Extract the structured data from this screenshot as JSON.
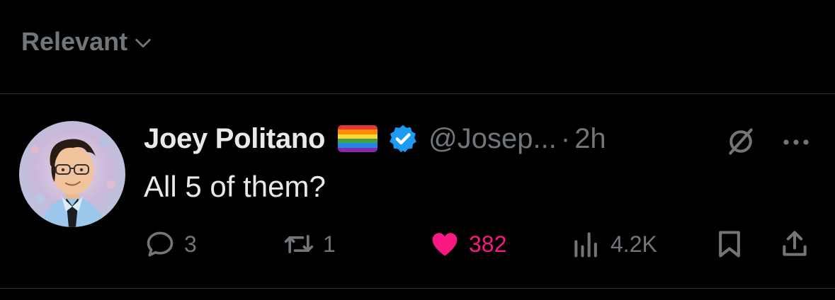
{
  "filter": {
    "label": "Relevant"
  },
  "post": {
    "display_name": "Joey Politano",
    "handle": "@Josep...",
    "separator": "·",
    "time": "2h",
    "text": "All 5 of them?",
    "stats": {
      "replies": "3",
      "reposts": "1",
      "likes": "382",
      "views": "4.2K"
    },
    "liked": true,
    "verified": true,
    "flag_emoji": "rainbow-flag"
  },
  "colors": {
    "background": "#000000",
    "primary_text": "#e7e9ea",
    "secondary_text": "#71767b",
    "divider": "#2f3336",
    "like": "#f91880",
    "verified": "#1d9bf0"
  },
  "icons": {
    "filter_chevron": "chevron-down-icon",
    "verified": "verified-badge-icon",
    "grok": "grok-icon",
    "more": "more-icon",
    "reply": "reply-icon",
    "repost": "repost-icon",
    "like": "heart-icon",
    "views": "views-icon",
    "bookmark": "bookmark-icon",
    "share": "share-icon"
  }
}
